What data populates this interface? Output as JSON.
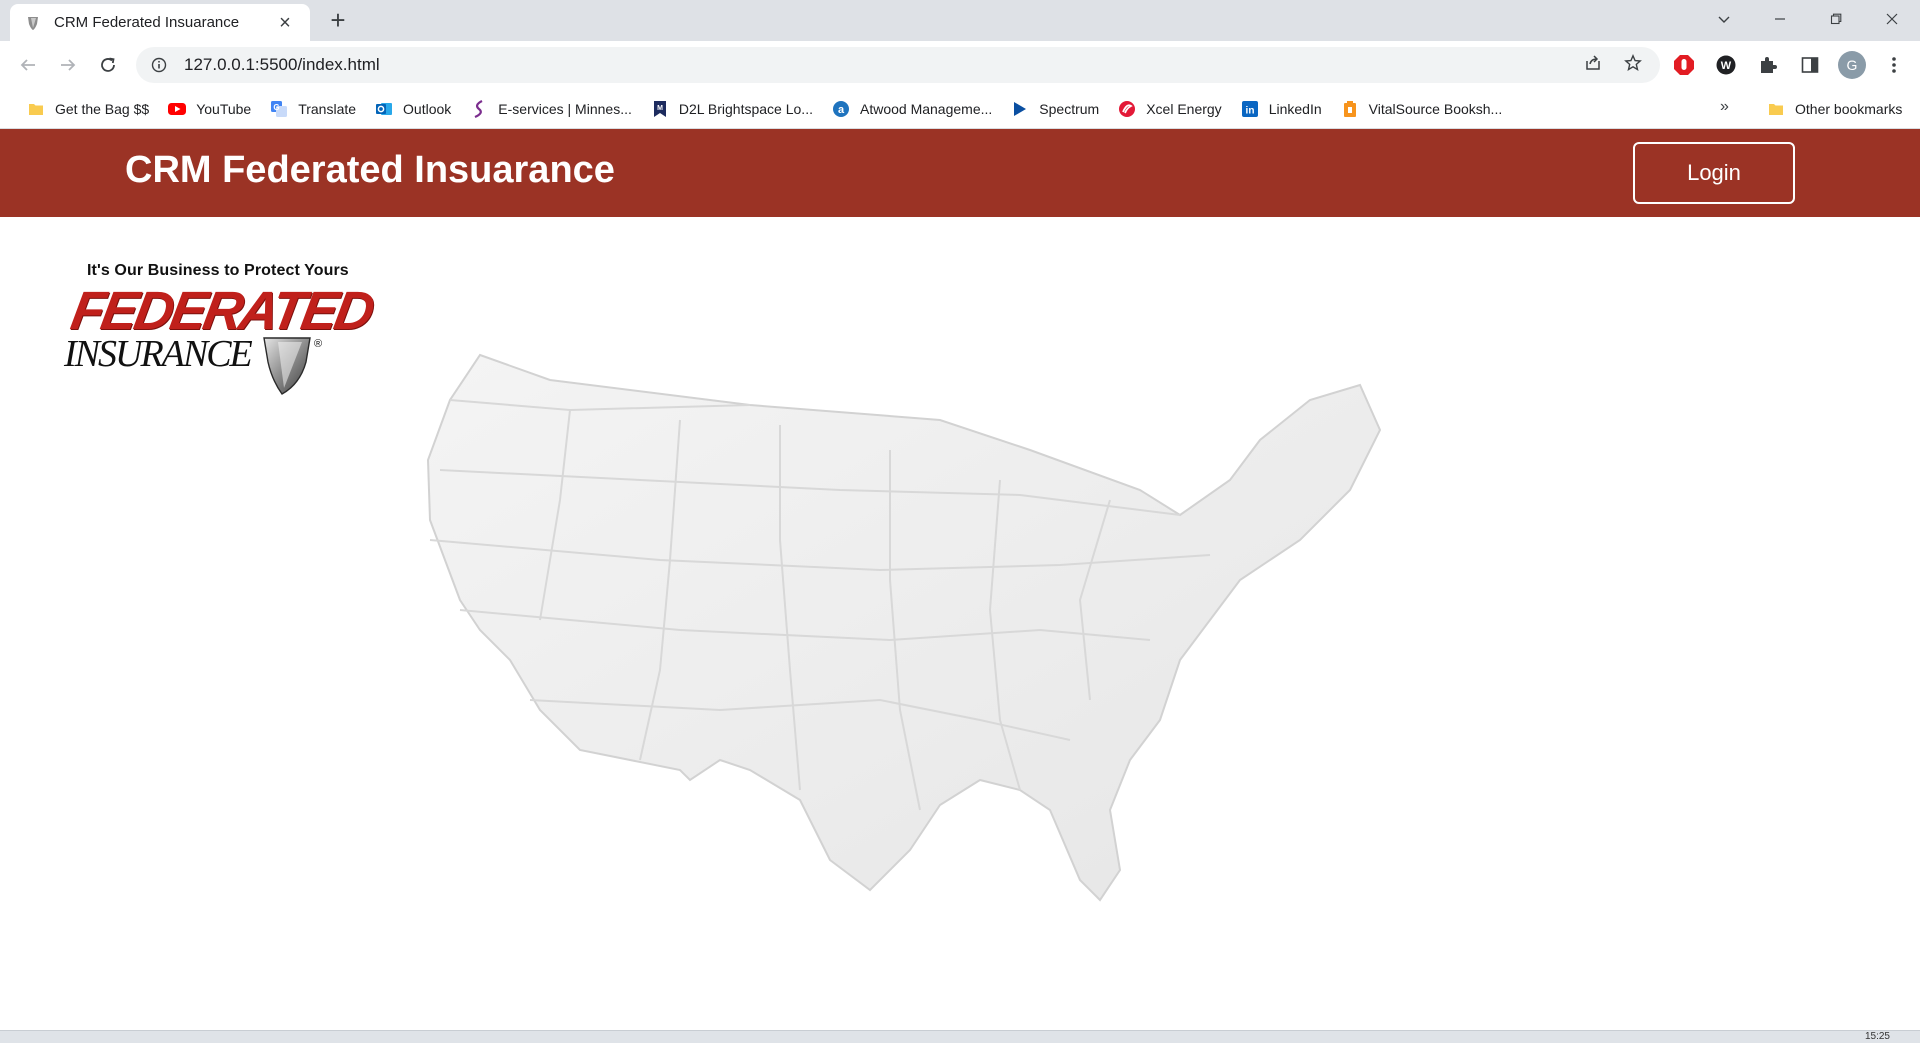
{
  "browser": {
    "tab": {
      "title": "CRM Federated Insuarance"
    },
    "address": {
      "url": "127.0.0.1:5500/index.html"
    },
    "profile_initial": "G",
    "bookmarks": [
      {
        "label": "Get the Bag $$",
        "icon": "folder-icon"
      },
      {
        "label": "YouTube",
        "icon": "youtube-icon"
      },
      {
        "label": "Translate",
        "icon": "translate-icon"
      },
      {
        "label": "Outlook",
        "icon": "outlook-icon"
      },
      {
        "label": "E-services | Minnes...",
        "icon": "eservices-icon"
      },
      {
        "label": "D2L Brightspace Lo...",
        "icon": "d2l-icon"
      },
      {
        "label": "Atwood Manageme...",
        "icon": "atwood-icon"
      },
      {
        "label": "Spectrum",
        "icon": "spectrum-icon"
      },
      {
        "label": "Xcel Energy",
        "icon": "xcel-icon"
      },
      {
        "label": "LinkedIn",
        "icon": "linkedin-icon"
      },
      {
        "label": "VitalSource Booksh...",
        "icon": "vitalsource-icon"
      }
    ],
    "more_bookmarks": "»",
    "other_bookmarks": "Other bookmarks"
  },
  "page": {
    "header_title": "CRM Federated Insuarance",
    "login_label": "Login",
    "logo": {
      "tagline": "It's Our Business to Protect Yours",
      "word_top": "FEDERATED",
      "word_bottom": "INSURANCE",
      "registered": "®"
    }
  },
  "taskbar": {
    "clock": "15:25"
  },
  "colors": {
    "header_bg": "#9b3325",
    "logo_red": "#c0201b",
    "map_fill": "#efefef"
  }
}
